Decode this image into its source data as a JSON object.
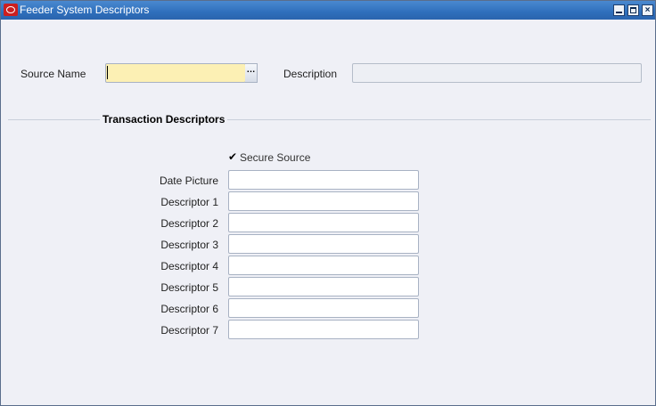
{
  "window": {
    "title": "Feeder System Descriptors",
    "icon": "oracle-icon"
  },
  "header": {
    "source_name_label": "Source Name",
    "source_name_value": "",
    "description_label": "Description",
    "description_value": ""
  },
  "section": {
    "title": "Transaction Descriptors"
  },
  "secure_source": {
    "label": "Secure Source",
    "checked": true
  },
  "fields": [
    {
      "label": "Date Picture",
      "value": ""
    },
    {
      "label": "Descriptor 1",
      "value": ""
    },
    {
      "label": "Descriptor 2",
      "value": ""
    },
    {
      "label": "Descriptor 3",
      "value": ""
    },
    {
      "label": "Descriptor 4",
      "value": ""
    },
    {
      "label": "Descriptor 5",
      "value": ""
    },
    {
      "label": "Descriptor 6",
      "value": ""
    },
    {
      "label": "Descriptor 7",
      "value": ""
    }
  ],
  "colors": {
    "titlebar": "#2f6fbc",
    "required_field": "#fcf0b4",
    "background": "#eff0f6"
  }
}
